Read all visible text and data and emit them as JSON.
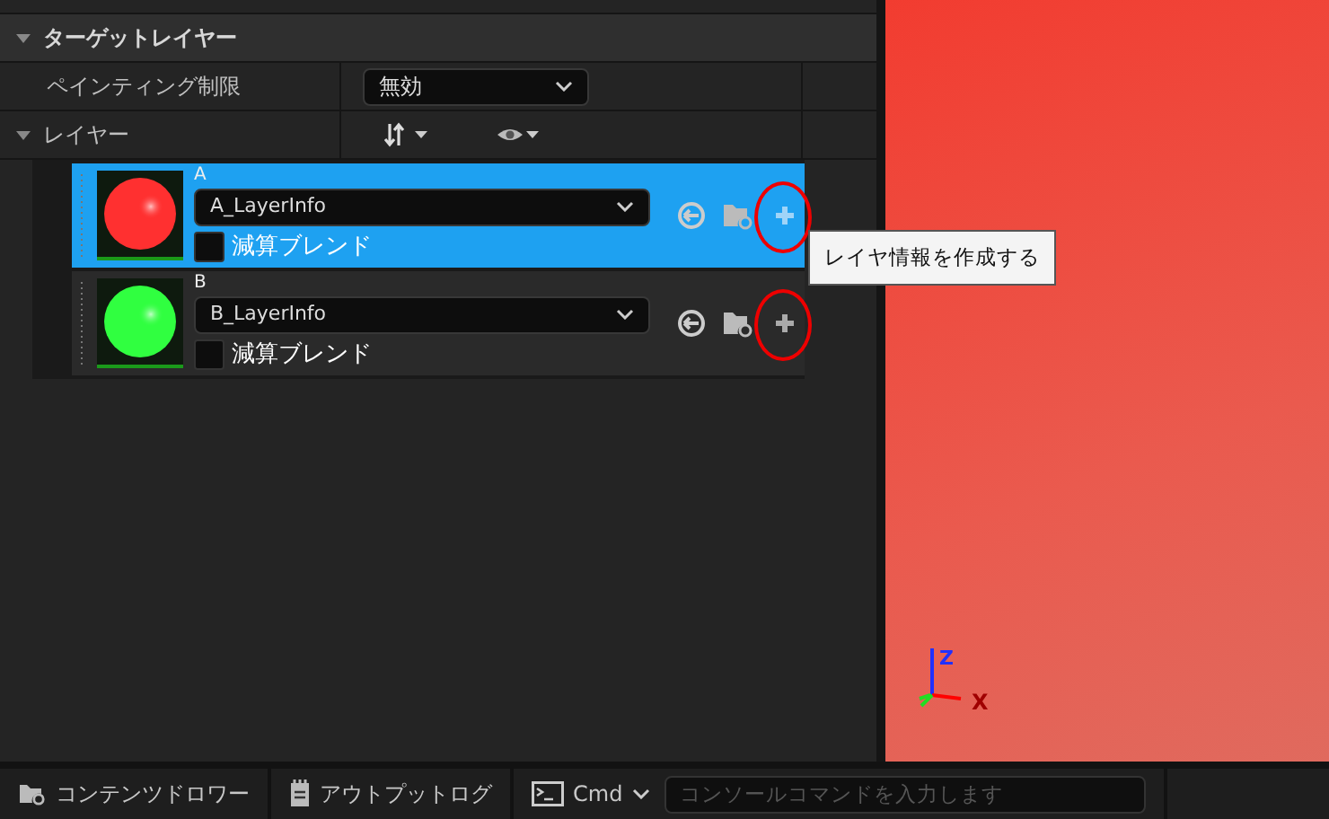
{
  "section": {
    "title": "ターゲットレイヤー",
    "expanded": true
  },
  "painting_restriction": {
    "label": "ペインティング制限",
    "value": "無効"
  },
  "layers_header": {
    "label": "レイヤー",
    "expanded": true
  },
  "layers": [
    {
      "name": "A",
      "info": "A_LayerInfo",
      "subtractive_label": "減算ブレンド",
      "subtractive": false,
      "selected": true,
      "color": "#ff3030",
      "annotated": true
    },
    {
      "name": "B",
      "info": "B_LayerInfo",
      "subtractive_label": "減算ブレンド",
      "subtractive": false,
      "selected": false,
      "color": "#30ff40",
      "annotated": true
    }
  ],
  "tooltip": "レイヤ情報を作成する",
  "viewport": {
    "axis_z": "Z",
    "axis_x": "X"
  },
  "bottom_bar": {
    "content_drawer": "コンテンツドロワー",
    "output_log": "アウトプットログ",
    "cmd": "Cmd",
    "console_placeholder": "コンソールコマンドを入力します"
  }
}
